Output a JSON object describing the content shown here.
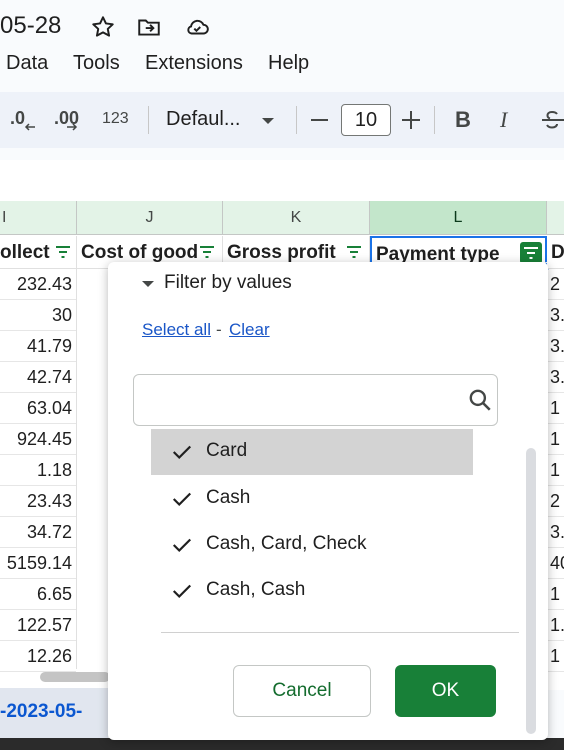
{
  "document": {
    "title": "05-28"
  },
  "menu": {
    "items": [
      {
        "label": "Data"
      },
      {
        "label": "Tools"
      },
      {
        "label": "Extensions"
      },
      {
        "label": "Help"
      }
    ]
  },
  "toolbar": {
    "decrease_decimal": ".0",
    "increase_decimal": ".00",
    "number_format": "123",
    "font_family": "Defaul...",
    "font_size": "10",
    "bold": "B",
    "italic": "I"
  },
  "columns": {
    "letters": [
      "I",
      "J",
      "K",
      "L",
      ""
    ],
    "headers": [
      "ollect",
      "Cost of good",
      "Gross profit",
      "Payment type",
      "D"
    ]
  },
  "rows": {
    "col_i": [
      "232.43",
      "30",
      "41.79",
      "42.74",
      "63.04",
      "924.45",
      "1.18",
      "23.43",
      "34.72",
      "5159.14",
      "6.65",
      "122.57",
      "12.26"
    ],
    "col_m": [
      "2",
      "3.",
      "3.",
      "3.",
      "1",
      "1",
      "1",
      "2",
      "3.",
      "40",
      "1",
      "1.",
      "1"
    ]
  },
  "filter": {
    "heading": "Filter by values",
    "select_all": "Select all",
    "separator": "-",
    "clear": "Clear",
    "search_placeholder": "",
    "values": [
      {
        "label": "Card",
        "checked": true
      },
      {
        "label": "Cash",
        "checked": true
      },
      {
        "label": "Cash, Card, Check",
        "checked": true
      },
      {
        "label": "Cash, Cash",
        "checked": true
      }
    ],
    "cancel": "Cancel",
    "ok": "OK"
  },
  "sheet_tab": {
    "label": "-2023-05-"
  },
  "colors": {
    "accent_green": "#188038",
    "link_blue": "#1a56c7",
    "header_green": "#e3f3e7"
  }
}
